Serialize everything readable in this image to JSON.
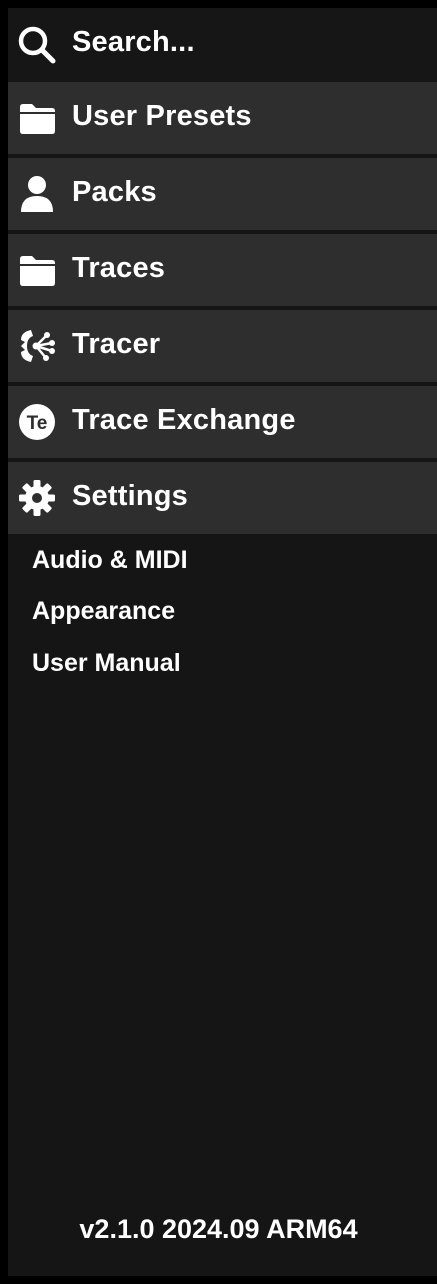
{
  "search": {
    "label": "Search..."
  },
  "nav": {
    "user_presets": "User Presets",
    "packs": "Packs",
    "traces": "Traces",
    "tracer": "Tracer",
    "trace_exchange": "Trace Exchange",
    "trace_exchange_badge": "Te",
    "settings": "Settings"
  },
  "settings_submenu": {
    "audio_midi": "Audio & MIDI",
    "appearance": "Appearance",
    "user_manual": "User Manual"
  },
  "footer": {
    "version": "v2.1.0 2024.09 ARM64"
  },
  "colors": {
    "background": "#151516",
    "row": "#2e2e2f",
    "text": "#ffffff"
  },
  "icons": [
    "search-icon",
    "folder-icon",
    "user-icon",
    "folder-icon",
    "tracer-icon",
    "trace-exchange-icon",
    "gear-icon"
  ]
}
